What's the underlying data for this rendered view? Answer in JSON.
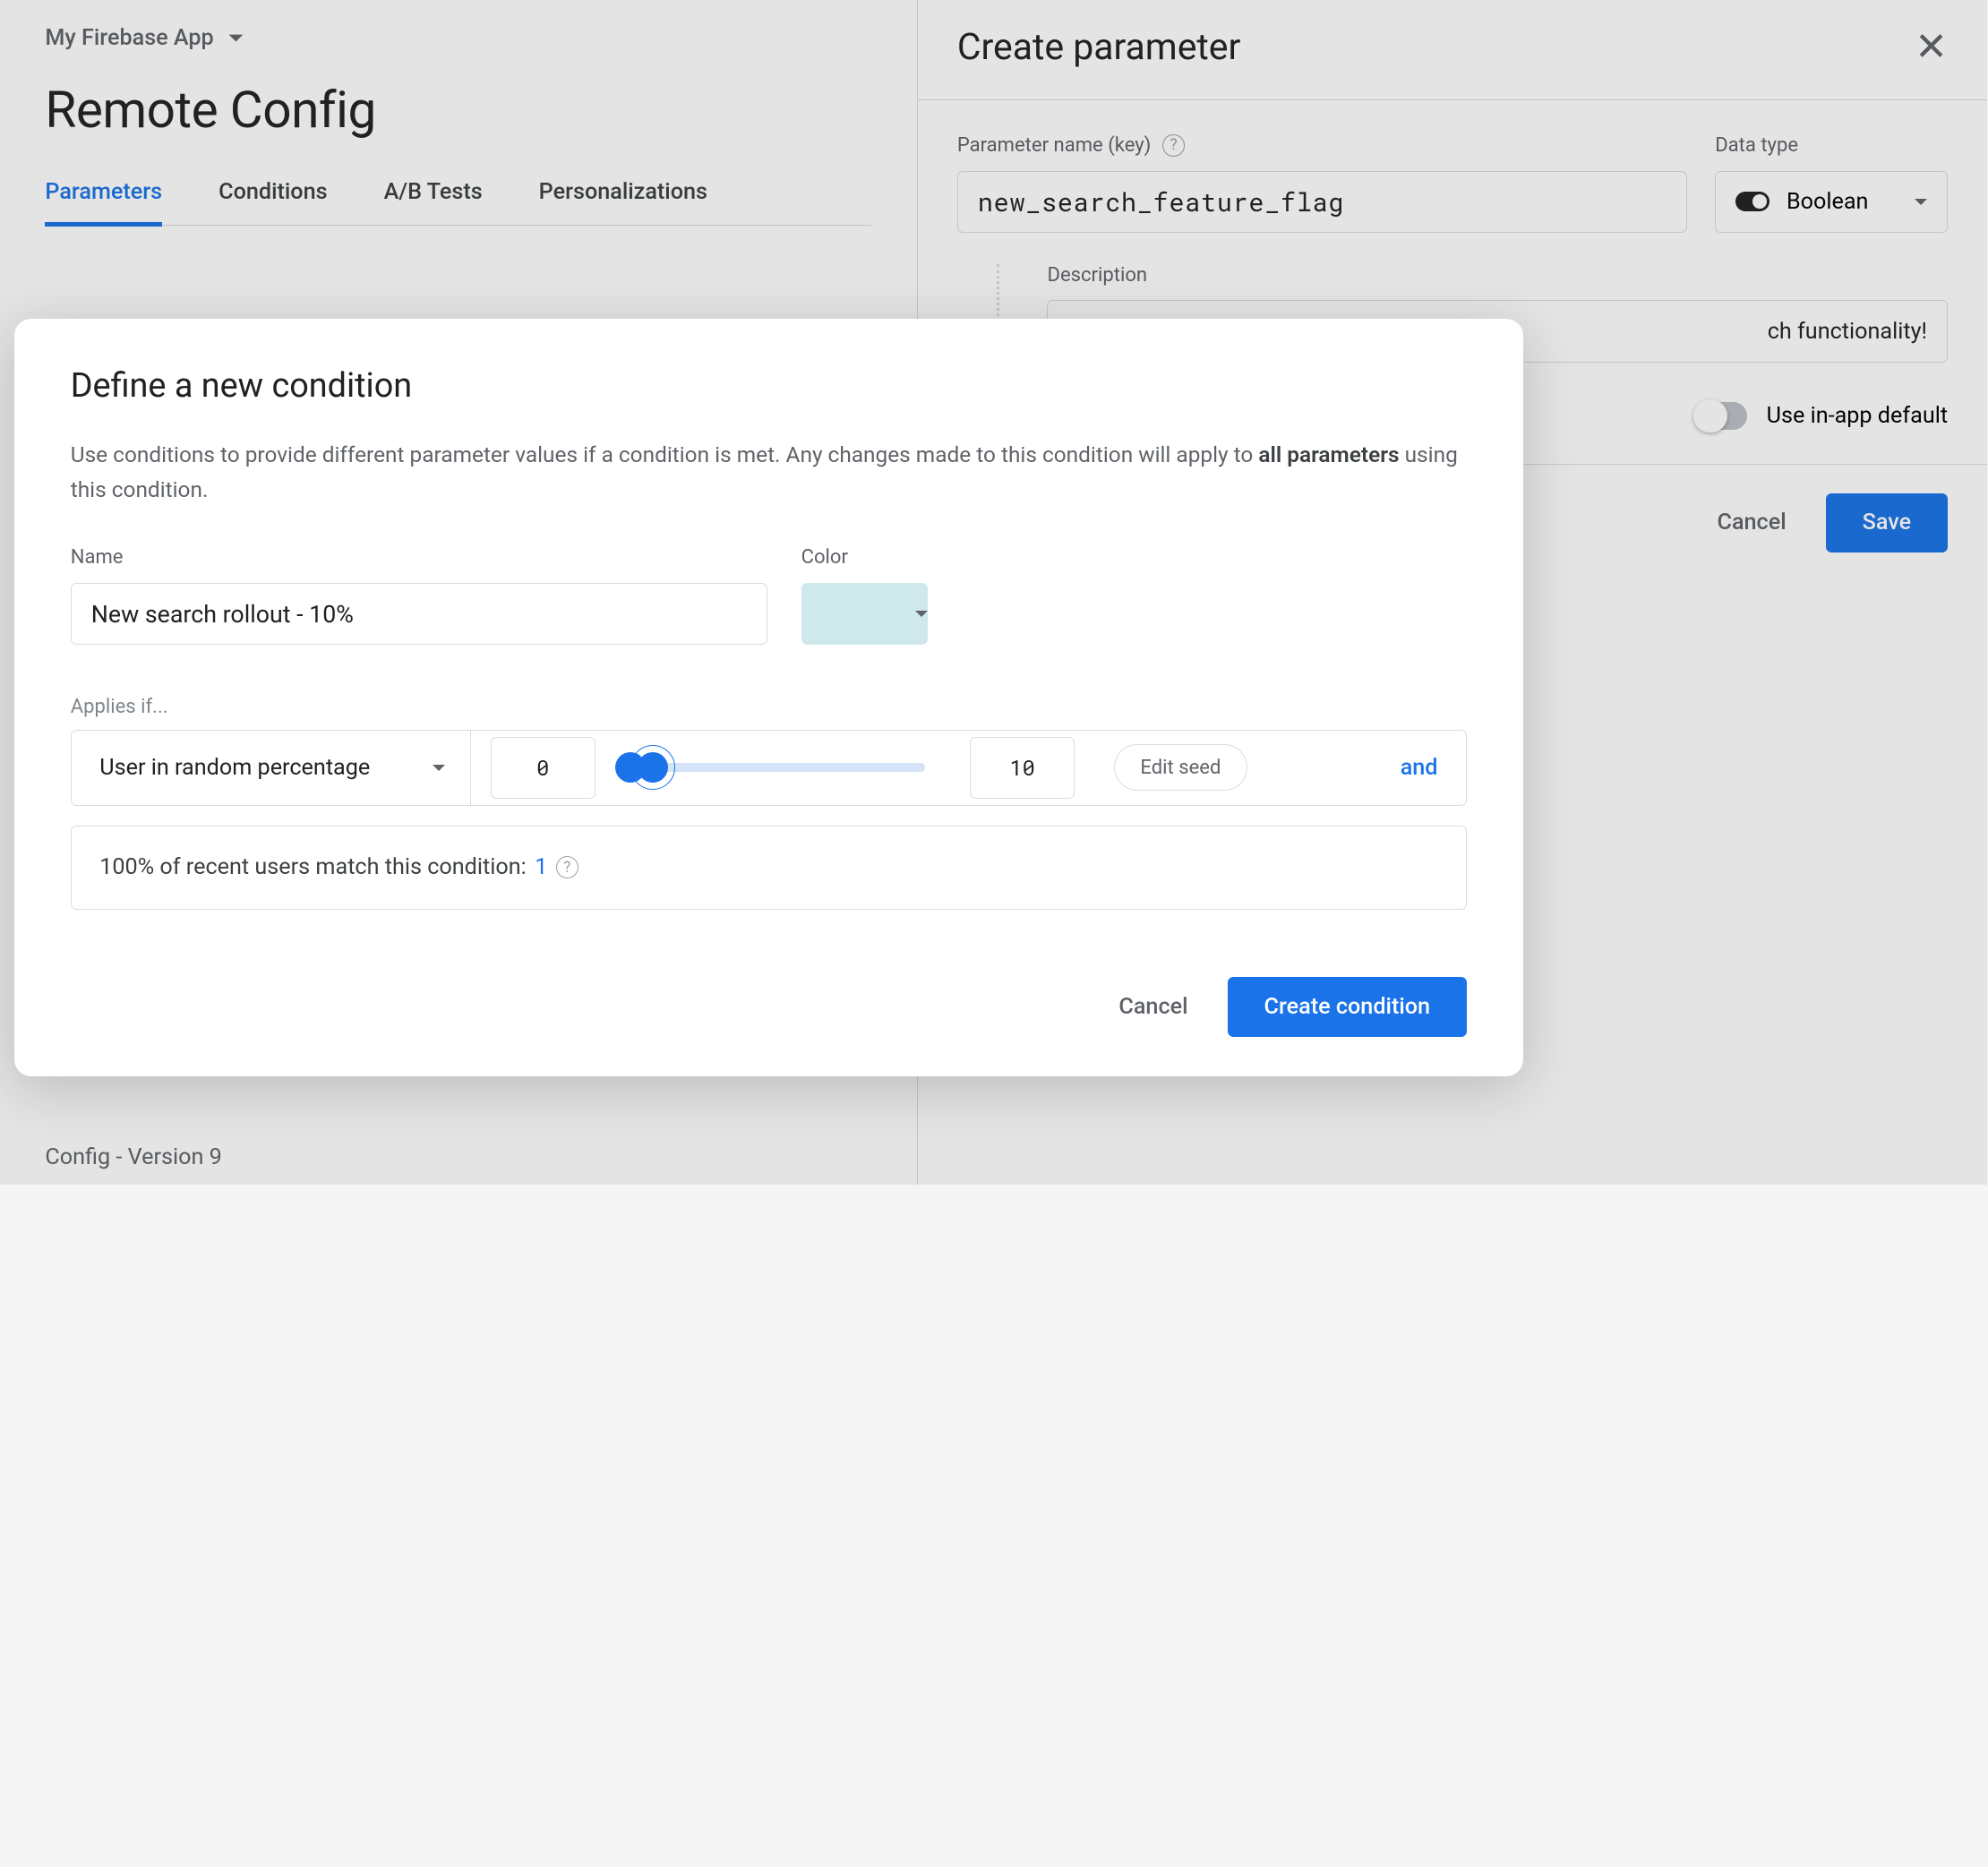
{
  "app_name": "My Firebase App",
  "page_title": "Remote Config",
  "tabs": [
    "Parameters",
    "Conditions",
    "A/B Tests",
    "Personalizations"
  ],
  "footer_version": "Config - Version 9",
  "side_panel": {
    "title": "Create parameter",
    "param_label": "Parameter name (key)",
    "param_value": "new_search_feature_flag",
    "datatype_label": "Data type",
    "datatype_value": "Boolean",
    "description_label": "Description",
    "description_value_suffix": "ch functionality!",
    "use_default_label": "Use in-app default",
    "cancel": "Cancel",
    "save": "Save"
  },
  "modal": {
    "title": "Define a new condition",
    "desc_1": "Use conditions to provide different parameter values if a condition is met. Any changes made to this condition will apply to ",
    "desc_bold": "all parameters",
    "desc_2": " using this condition.",
    "name_label": "Name",
    "name_value": "New search rollout - 10%",
    "color_label": "Color",
    "applies_label": "Applies if...",
    "condition_type": "User in random percentage",
    "range_low": "0",
    "range_high": "10",
    "edit_seed": "Edit seed",
    "and": "and",
    "match_text": "100% of recent users match this condition: ",
    "match_count": "1",
    "cancel": "Cancel",
    "create": "Create condition"
  }
}
